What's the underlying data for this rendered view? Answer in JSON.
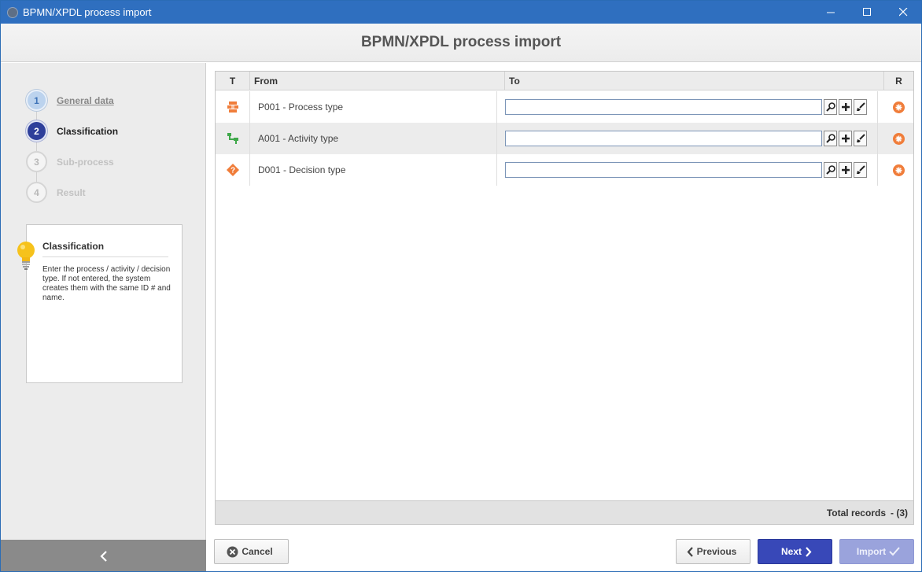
{
  "window": {
    "title": "BPMN/XPDL process import",
    "accent_color": "#2f6fbf"
  },
  "header": {
    "title": "BPMN/XPDL process import"
  },
  "steps": [
    {
      "number": "1",
      "label": "General data",
      "state": "done"
    },
    {
      "number": "2",
      "label": "Classification",
      "state": "active"
    },
    {
      "number": "3",
      "label": "Sub-process",
      "state": "todo"
    },
    {
      "number": "4",
      "label": "Result",
      "state": "todo"
    }
  ],
  "hint": {
    "title": "Classification",
    "text": "Enter the process / activity / decision type. If not entered, the system creates them with the same ID # and name."
  },
  "grid": {
    "columns": {
      "t": "T",
      "from": "From",
      "to": "To",
      "r": "R"
    },
    "rows": [
      {
        "type_icon": "process-type-icon",
        "from": "P001 - Process type",
        "to_value": ""
      },
      {
        "type_icon": "activity-type-icon",
        "from": "A001 - Activity type",
        "to_value": ""
      },
      {
        "type_icon": "decision-type-icon",
        "from": "D001 - Decision type",
        "to_value": ""
      }
    ],
    "total_label": "Total records",
    "total_count": "- (3)"
  },
  "buttons": {
    "cancel": "Cancel",
    "previous": "Previous",
    "next": "Next",
    "import": "Import"
  }
}
